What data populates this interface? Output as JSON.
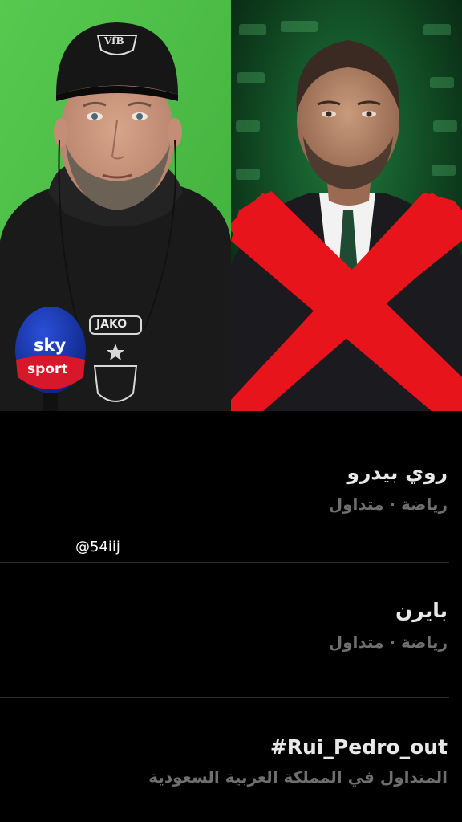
{
  "media": {
    "left_photo": {
      "subject": "coach-headshot",
      "cap_logo_text": "VfB",
      "hoodie_logo_text": "JAKO",
      "mic_flag_line1": "sky",
      "mic_flag_line2": "sport"
    },
    "right_photo": {
      "subject": "suited-man-crossed-out",
      "overlay": "red-x",
      "overlay_color": "#e8141b"
    }
  },
  "watermark": "@54iij",
  "trends": [
    {
      "title": "روي بيدرو",
      "meta": "رياضة · متداول"
    },
    {
      "title": "بايرن",
      "meta": "رياضة · متداول"
    },
    {
      "title": "#Rui_Pedro_out",
      "meta": "المتداول في المملكة العربية السعودية"
    }
  ],
  "colors": {
    "background": "#000000",
    "title": "#e8e8e8",
    "meta": "#6f6f6f",
    "green_screen": "#4fbf4a"
  }
}
